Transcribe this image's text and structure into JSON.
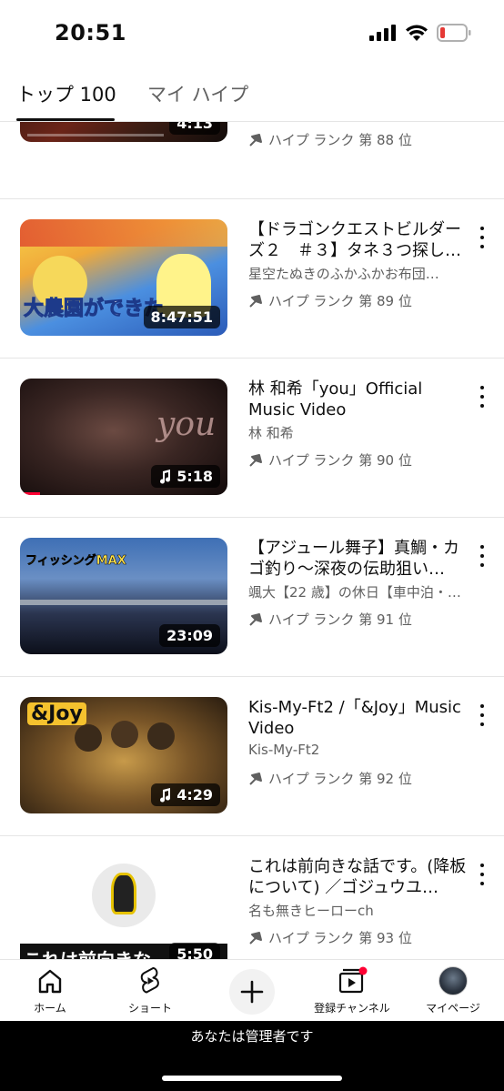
{
  "status_bar": {
    "time": "20:51"
  },
  "tabs": [
    {
      "label": "トップ 100",
      "active": true
    },
    {
      "label": "マイ ハイプ",
      "active": false
    }
  ],
  "videos": [
    {
      "title": "",
      "channel": "",
      "rank": "ハイプ ランク 第 88 位",
      "duration": "4:13",
      "music": false,
      "colors": [
        "#3a1f18",
        "#7a2a1f",
        "#1c1410"
      ]
    },
    {
      "title": "【ドラゴンクエストビルダーズ２　＃３】タネ３つ探し…",
      "channel": "星空たぬきのふかふかお布団…",
      "rank": "ハイプ ランク 第 89 位",
      "duration": "8:47:51",
      "music": false,
      "thumb_text": "大農園ができた",
      "colors": [
        "#f5c542",
        "#3b82f6",
        "#e0522f"
      ]
    },
    {
      "title": "林 和希「you」Official Music Video",
      "channel": "林 和希",
      "rank": "ハイプ ランク 第 90 位",
      "duration": "5:18",
      "music": true,
      "thumb_text": "you",
      "colors": [
        "#1a1010",
        "#5a3a33",
        "#2b1a18"
      ]
    },
    {
      "title": "【アジュール舞子】真鯛・カゴ釣り〜深夜の伝助狙い…",
      "channel": "颯大【22 歳】の休日【車中泊・…",
      "rank": "ハイプ ランク 第 91 位",
      "duration": "23:09",
      "music": false,
      "thumb_text": "フィッシングMAX",
      "colors": [
        "#1e2a44",
        "#4a6fa5",
        "#0e1424"
      ]
    },
    {
      "title": "Kis-My-Ft2 /「&Joy」Music Video",
      "channel": "Kis-My-Ft2",
      "rank": "ハイプ ランク 第 92 位",
      "duration": "4:29",
      "music": true,
      "thumb_text": "&Joy",
      "colors": [
        "#b58a3a",
        "#5a4020",
        "#2a1e12"
      ]
    },
    {
      "title": "これは前向きな話です。(降板について) ／ゴジュウユ…",
      "channel": "名も無きヒーローch",
      "rank": "ハイプ ランク 第 93 位",
      "duration": "5:50",
      "music": false,
      "thumb_text": "これは前向きな",
      "colors": [
        "#ffffff",
        "#f2f2f2",
        "#111111"
      ]
    }
  ],
  "bottom_nav": {
    "home": "ホーム",
    "shorts": "ショート",
    "subscriptions": "登録チャンネル",
    "mypage": "マイページ"
  },
  "admin_banner": "あなたは管理者です"
}
